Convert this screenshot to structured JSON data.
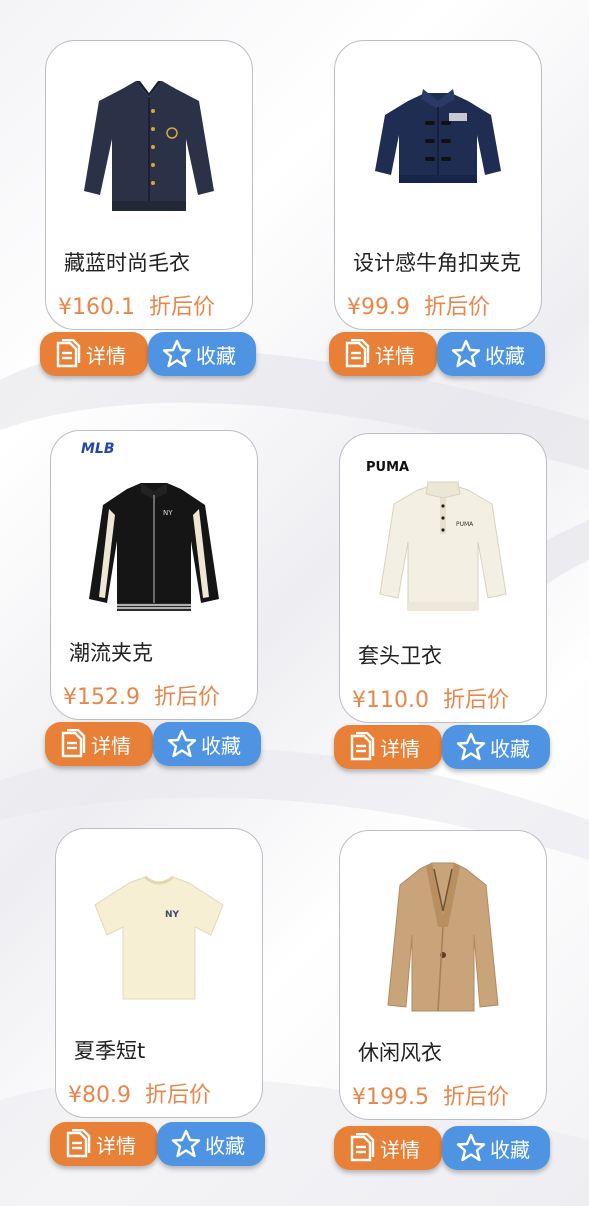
{
  "buttons": {
    "detail_label": "详情",
    "fav_label": "收藏"
  },
  "products": [
    {
      "name": "藏蓝时尚毛衣",
      "price": "¥160.1",
      "discount_label": "折后价",
      "image": "navy-cardigan-icon"
    },
    {
      "name": "设计感牛角扣夹克",
      "price": "¥99.9",
      "discount_label": "折后价",
      "image": "navy-toggle-jacket-icon"
    },
    {
      "name": "潮流夹克",
      "price": "¥152.9",
      "discount_label": "折后价",
      "image": "black-track-jacket-icon",
      "brand_logo": "MLB"
    },
    {
      "name": "套头卫衣",
      "price": "¥110.0",
      "discount_label": "折后价",
      "image": "cream-pullover-icon",
      "brand_logo": "PUMA"
    },
    {
      "name": "夏季短t",
      "price": "¥80.9",
      "discount_label": "折后价",
      "image": "cream-tshirt-icon"
    },
    {
      "name": "休闲风衣",
      "price": "¥199.5",
      "discount_label": "折后价",
      "image": "camel-coat-icon"
    }
  ],
  "colors": {
    "detail_button": "#e98037",
    "fav_button": "#4f94e2",
    "price": "#e8874c"
  }
}
